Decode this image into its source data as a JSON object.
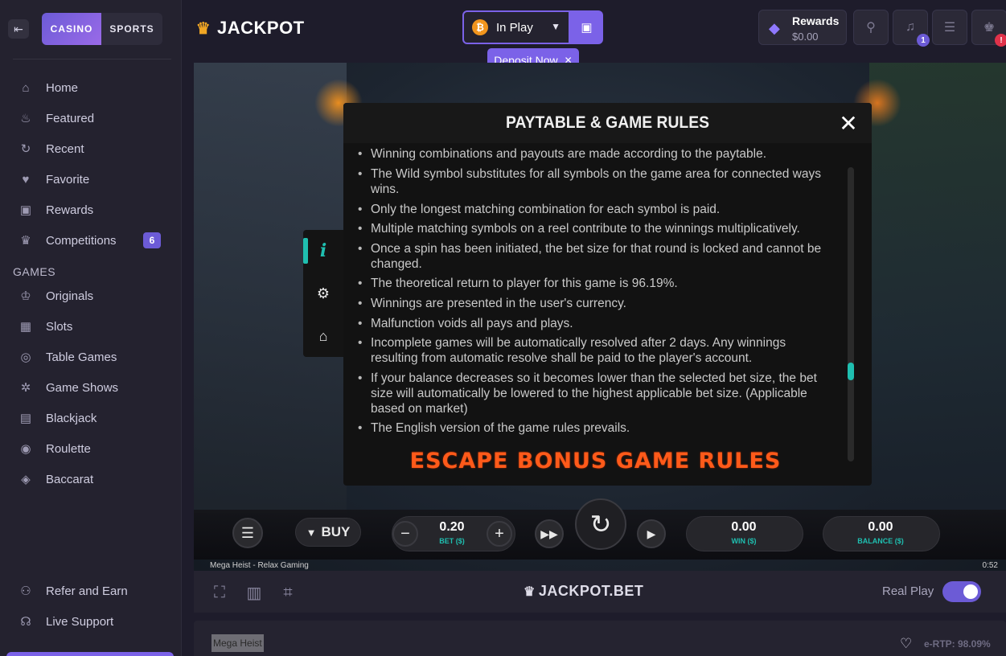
{
  "sidebar": {
    "modes": [
      "CASINO",
      "SPORTS"
    ],
    "items": [
      {
        "label": "Home",
        "icon": "house-icon"
      },
      {
        "label": "Featured",
        "icon": "fire-icon"
      },
      {
        "label": "Recent",
        "icon": "history-icon"
      },
      {
        "label": "Favorite",
        "icon": "heart-icon"
      },
      {
        "label": "Rewards",
        "icon": "gift-icon"
      },
      {
        "label": "Competitions",
        "icon": "trophy-icon",
        "badge": "6"
      }
    ],
    "games_heading": "GAMES",
    "games": [
      {
        "label": "Originals",
        "icon": "crown-icon"
      },
      {
        "label": "Slots",
        "icon": "slot-machine-icon"
      },
      {
        "label": "Table Games",
        "icon": "table-icon"
      },
      {
        "label": "Game Shows",
        "icon": "game-show-icon"
      },
      {
        "label": "Blackjack",
        "icon": "cards-icon"
      },
      {
        "label": "Roulette",
        "icon": "roulette-icon"
      },
      {
        "label": "Baccarat",
        "icon": "baccarat-icon"
      }
    ],
    "footer": [
      {
        "label": "Refer and Earn",
        "icon": "refer-icon"
      },
      {
        "label": "Live Support",
        "icon": "headset-icon"
      }
    ]
  },
  "header": {
    "logo": "JACKPOT",
    "balance_selector": {
      "label": "In Play",
      "currency_icon": "bitcoin-icon"
    },
    "deposit_tooltip": "Deposit Now",
    "rewards": {
      "title": "Rewards",
      "amount": "$0.00"
    },
    "notification_count": "1",
    "alert_badge": "!"
  },
  "modal": {
    "title": "PAYTABLE & GAME RULES",
    "rules": [
      "Winning combinations and payouts are made according to the paytable.",
      "The Wild symbol substitutes for all symbols on the game area for connected ways wins.",
      "Only the longest matching combination for each symbol is paid.",
      "Multiple matching symbols on a reel contribute to the winnings multiplicatively.",
      "Once a spin has been initiated, the bet size for that round is locked and cannot be changed.",
      "The theoretical return to player for this game is 96.19%.",
      "Winnings are presented in the user's currency.",
      "Malfunction voids all pays and plays.",
      "Incomplete games will be automatically resolved after 2 days. Any winnings resulting from automatic resolve shall be paid to the player's account.",
      "If your balance decreases so it becomes lower than the selected bet size, the bet size will automatically be lowered to the highest applicable bet size. (Applicable based on market)",
      "The English version of the game rules prevails."
    ],
    "bonus_heading": "ESCAPE BONUS GAME RULES",
    "scroll_position": 0.72
  },
  "game_controls": {
    "buy_label": "BUY",
    "bet": {
      "value": "0.20",
      "label": "BET ($)"
    },
    "win": {
      "value": "0.00",
      "label": "WIN ($)"
    },
    "balance": {
      "value": "0.00",
      "label": "BALANCE ($)"
    }
  },
  "game_caption": "Mega Heist - Relax Gaming",
  "game_time": "0:52",
  "toolbar": {
    "logo": "JACKPOT.BET",
    "real_play_label": "Real Play",
    "real_play_on": true
  },
  "infobar": {
    "game_name": "Mega Heist",
    "ertp": "e-RTP: 98.09%"
  },
  "colors": {
    "accent": "#7b62e8",
    "teal": "#1fbfb0",
    "bonus_orange": "#ff5a1a"
  }
}
